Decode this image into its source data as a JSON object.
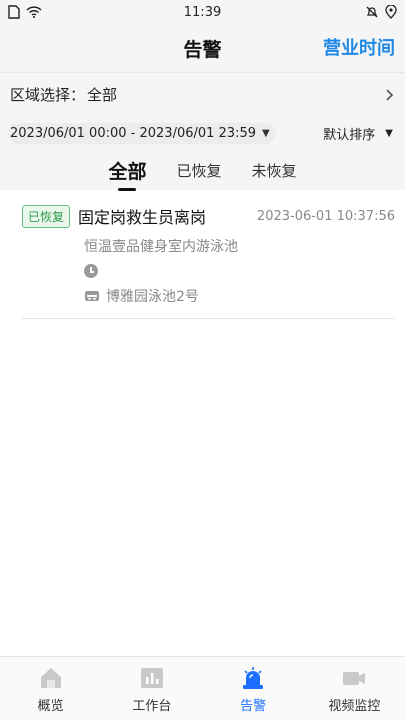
{
  "status_bar": {
    "time": "11:39"
  },
  "header": {
    "title": "告警",
    "action": "营业时间"
  },
  "region": {
    "label": "区域选择：",
    "value": "全部"
  },
  "filter": {
    "date_range": "2023/06/01 00:00 - 2023/06/01 23:59",
    "sort_label": "默认排序"
  },
  "tabs": [
    {
      "label": "全部",
      "active": true
    },
    {
      "label": "已恢复",
      "active": false
    },
    {
      "label": "未恢复",
      "active": false
    }
  ],
  "alarms": [
    {
      "badge": "已恢复",
      "title": "固定岗救生员离岗",
      "time": "2023-06-01 10:37:56",
      "venue": "恒温壹品健身室内游泳池",
      "pool": "博雅园泳池2号"
    }
  ],
  "tabbar": [
    {
      "label": "概览",
      "icon": "home-icon"
    },
    {
      "label": "工作台",
      "icon": "workbench-icon"
    },
    {
      "label": "告警",
      "icon": "alarm-icon",
      "active": true
    },
    {
      "label": "视频监控",
      "icon": "camera-icon"
    }
  ],
  "colors": {
    "accent": "#1e6fff",
    "badge_green": "#2e9b4a",
    "action_blue": "#1e88e5"
  }
}
